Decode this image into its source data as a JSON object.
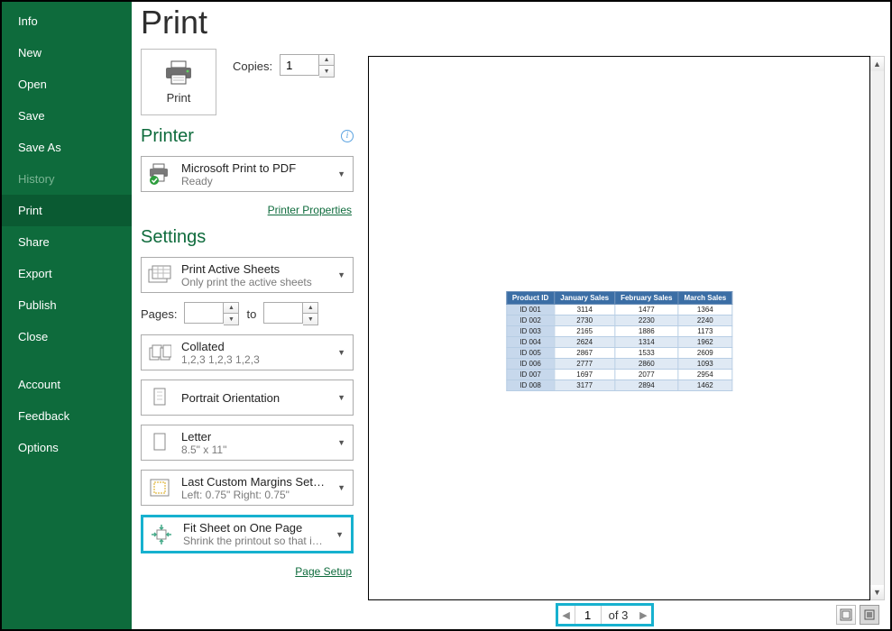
{
  "sidebar": {
    "items": [
      {
        "label": "Info"
      },
      {
        "label": "New"
      },
      {
        "label": "Open"
      },
      {
        "label": "Save"
      },
      {
        "label": "Save As"
      },
      {
        "label": "History"
      },
      {
        "label": "Print"
      },
      {
        "label": "Share"
      },
      {
        "label": "Export"
      },
      {
        "label": "Publish"
      },
      {
        "label": "Close"
      },
      {
        "label": "Account"
      },
      {
        "label": "Feedback"
      },
      {
        "label": "Options"
      }
    ]
  },
  "page": {
    "title": "Print"
  },
  "print_panel": {
    "print_label": "Print",
    "copies_label": "Copies:",
    "copies_value": "1"
  },
  "printer": {
    "heading": "Printer",
    "name": "Microsoft Print to PDF",
    "status": "Ready",
    "properties_link": "Printer Properties"
  },
  "settings": {
    "heading": "Settings",
    "print_what": {
      "title": "Print Active Sheets",
      "sub": "Only print the active sheets"
    },
    "pages": {
      "label": "Pages:",
      "to_label": "to",
      "from": "",
      "to_val": ""
    },
    "collate": {
      "title": "Collated",
      "sub": "1,2,3    1,2,3    1,2,3"
    },
    "orientation": {
      "title": "Portrait Orientation"
    },
    "paper": {
      "title": "Letter",
      "sub": "8.5\" x 11\""
    },
    "margins": {
      "title": "Last Custom Margins Setting",
      "sub": "Left:  0.75\"    Right:  0.75\""
    },
    "scaling": {
      "title": "Fit Sheet on One Page",
      "sub": "Shrink the printout so that it…"
    },
    "page_setup_link": "Page Setup"
  },
  "preview": {
    "current_page": "1",
    "of_label": "of 3",
    "table": {
      "headers": [
        "Product ID",
        "January Sales",
        "February Sales",
        "March Sales"
      ],
      "rows": [
        [
          "ID 001",
          "3114",
          "1477",
          "1364"
        ],
        [
          "ID 002",
          "2730",
          "2230",
          "2240"
        ],
        [
          "ID 003",
          "2165",
          "1886",
          "1173"
        ],
        [
          "ID 004",
          "2624",
          "1314",
          "1962"
        ],
        [
          "ID 005",
          "2867",
          "1533",
          "2609"
        ],
        [
          "ID 006",
          "2777",
          "2860",
          "1093"
        ],
        [
          "ID 007",
          "1697",
          "2077",
          "2954"
        ],
        [
          "ID 008",
          "3177",
          "2894",
          "1462"
        ]
      ]
    }
  }
}
